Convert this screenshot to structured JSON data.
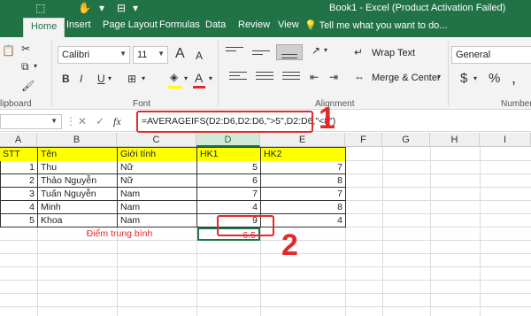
{
  "window": {
    "title": "Book1 - Excel (Product Activation Failed)",
    "accent": "#217346"
  },
  "ribbon_tabs": [
    "Home",
    "Insert",
    "Page Layout",
    "Formulas",
    "Data",
    "Review",
    "View"
  ],
  "tell_me": "Tell me what you want to do...",
  "ribbon": {
    "clipboard_label": "lipboard",
    "font_name": "Calibri",
    "font_size": "11",
    "font_label": "Font",
    "wrap_text": "Wrap Text",
    "merge_center": "Merge & Center",
    "alignment_label": "Alignment",
    "number_format": "General",
    "number_label": "Number",
    "bold": "B",
    "italic": "I",
    "underline": "U",
    "currency": "$",
    "percent": "%",
    "fx": "fx",
    "increase_font": "A",
    "decrease_font": "A"
  },
  "formula_bar": {
    "formula": "=AVERAGEIFS(D2:D6,D2:D6,\">5\",D2:D6,\"<8\")"
  },
  "callouts": {
    "one": "1",
    "two": "2"
  },
  "columns": [
    "A",
    "B",
    "C",
    "D",
    "E",
    "F",
    "G",
    "H",
    "I"
  ],
  "table": {
    "headers": [
      "STT",
      "Tên",
      "Giới tính",
      "HK1",
      "HK2"
    ],
    "rows": [
      [
        "1",
        "Thu",
        "Nữ",
        "5",
        "7"
      ],
      [
        "2",
        "Thảo Nguyễn",
        "Nữ",
        "6",
        "8"
      ],
      [
        "3",
        "Tuấn Nguyễn",
        "Nam",
        "7",
        "7"
      ],
      [
        "4",
        "Minh",
        "Nam",
        "4",
        "8"
      ],
      [
        "5",
        "Khoa",
        "Nam",
        "9",
        "4"
      ]
    ],
    "avg_label": "Điểm trung bình",
    "avg_value": "6.5"
  },
  "colors": {
    "highlight": "#ffff00",
    "callout_red": "#e12a2a",
    "selected_header": "#d3e9d8"
  }
}
